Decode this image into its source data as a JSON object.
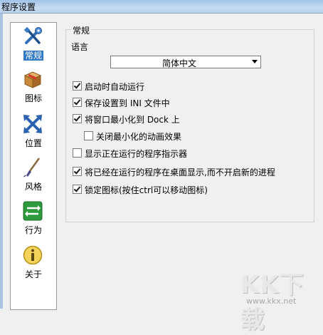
{
  "window": {
    "title": "程序设置"
  },
  "sidebar": {
    "items": [
      {
        "label": "常规",
        "icon": "tools-icon",
        "active": true
      },
      {
        "label": "图标",
        "icon": "package-icon",
        "active": false
      },
      {
        "label": "位置",
        "icon": "move-arrows-icon",
        "active": false
      },
      {
        "label": "风格",
        "icon": "brush-icon",
        "active": false
      },
      {
        "label": "行为",
        "icon": "swap-arrows-icon",
        "active": false
      },
      {
        "label": "关于",
        "icon": "info-icon",
        "active": false
      }
    ]
  },
  "general": {
    "group_title": "常规",
    "language_label": "语言",
    "language_value": "简体中文",
    "options": [
      {
        "label": "启动时自动运行",
        "checked": true
      },
      {
        "label": "保存设置到 INI 文件中",
        "checked": true
      },
      {
        "label": "将窗口最小化到 Dock 上",
        "checked": true
      },
      {
        "label": "关闭最小化的动画效果",
        "checked": false
      },
      {
        "label": "显示正在运行的程序指示器",
        "checked": false
      },
      {
        "label": "将已经在运行的程序在桌面显示,而不开启新的进程",
        "checked": true
      },
      {
        "label": "锁定图标(按住ctrl可以移动图标)",
        "checked": true
      }
    ]
  },
  "watermark": {
    "brand": "KK下载",
    "url": "www.kkx.net"
  },
  "colors": {
    "accent": "#3178c6",
    "titlebar": "#b9d1ea"
  }
}
